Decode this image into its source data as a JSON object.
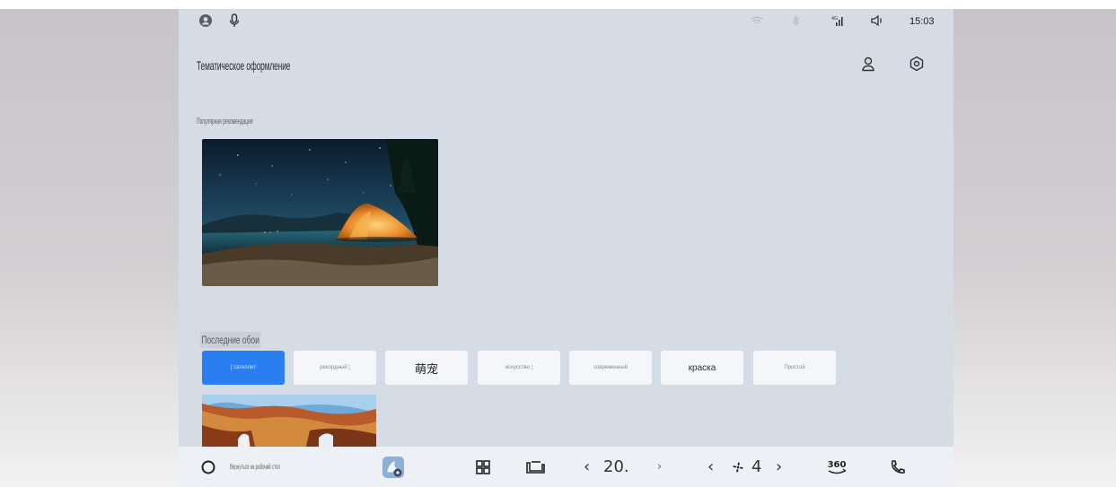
{
  "browser_link": "",
  "status_bar": {
    "time": "15:03"
  },
  "header": {
    "title": "Тематическое оформление"
  },
  "sections": {
    "popular_label": "Популярная рекомендация",
    "recent_label": "Последние обои"
  },
  "category_tabs": [
    {
      "label": "[ сателлит",
      "active": true
    },
    {
      "label": "рекордный ¦",
      "active": false
    },
    {
      "label": "萌宠",
      "active": false
    },
    {
      "label": "искусство ¦",
      "active": false
    },
    {
      "label": "современный",
      "active": false
    },
    {
      "label": "краска",
      "active": false
    },
    {
      "label": "Простой",
      "active": false
    }
  ],
  "dock": {
    "assistant_text": "Вернуться на рабочий стол",
    "temp_left": "20.",
    "fan_speed": "4",
    "view_360": "360"
  }
}
